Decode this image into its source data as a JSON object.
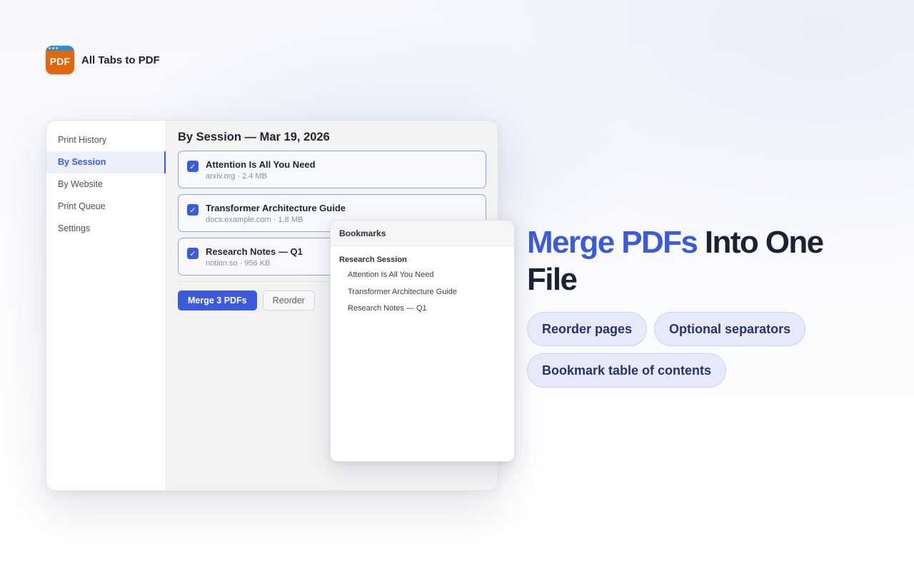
{
  "brand": {
    "icon_text": "PDF",
    "name": "All Tabs to PDF"
  },
  "sidebar": {
    "items": [
      {
        "label": "Print History",
        "active": false
      },
      {
        "label": "By Session",
        "active": true
      },
      {
        "label": "By Website",
        "active": false
      },
      {
        "label": "Print Queue",
        "active": false
      },
      {
        "label": "Settings",
        "active": false
      }
    ]
  },
  "main": {
    "title": "By Session — Mar 19, 2026",
    "items": [
      {
        "title": "Attention Is All You Need",
        "meta": "arxiv.org · 2.4 MB",
        "checked": true
      },
      {
        "title": "Transformer Architecture Guide",
        "meta": "docs.example.com · 1.8 MB",
        "checked": true
      },
      {
        "title": "Research Notes — Q1",
        "meta": "notion.so · 956 KB",
        "checked": true
      }
    ],
    "merge_label": "Merge 3 PDFs",
    "reorder_label": "Reorder"
  },
  "bookmarks": {
    "header": "Bookmarks",
    "group": "Research Session",
    "items": [
      "Attention Is All You Need",
      "Transformer Architecture Guide",
      "Research Notes — Q1"
    ]
  },
  "hero": {
    "accent": "Merge PDFs",
    "rest": " Into One File",
    "pills": [
      "Reorder pages",
      "Optional separators",
      "Bookmark table of contents"
    ]
  },
  "colors": {
    "accent": "#3b5bdb",
    "icon_orange": "#e0660f",
    "pill_bg": "#e6eafb"
  }
}
